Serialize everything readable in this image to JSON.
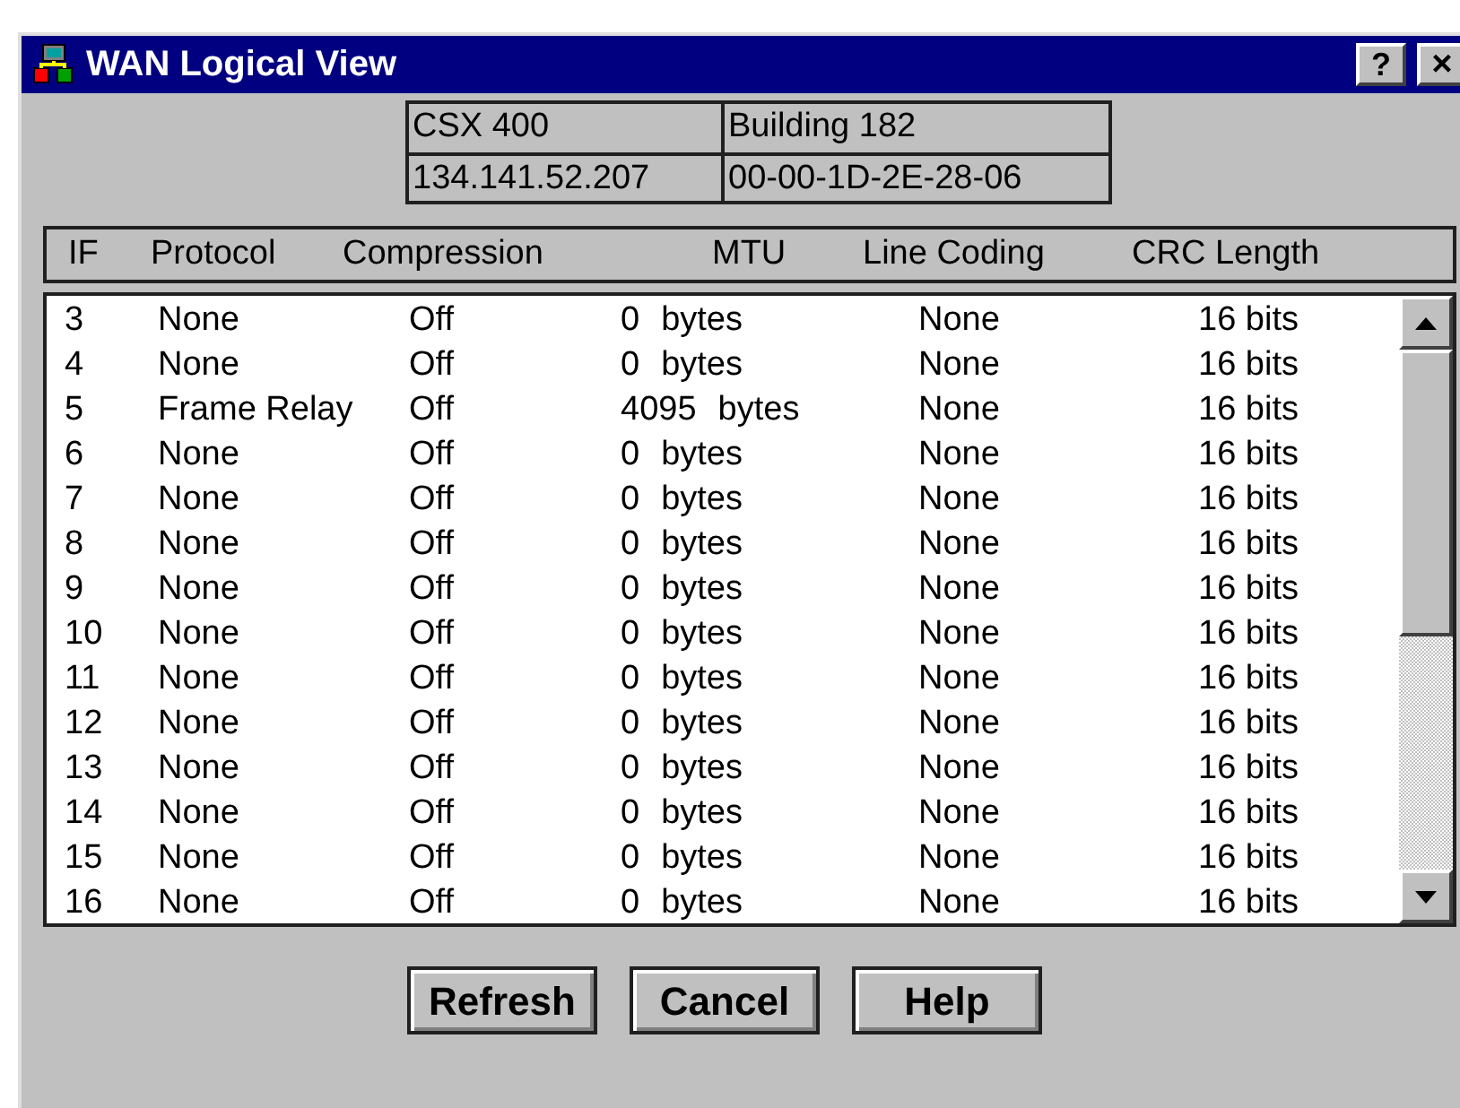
{
  "window": {
    "title": "WAN Logical View",
    "help_button": "?",
    "close_button": "×"
  },
  "device_info": [
    [
      "CSX 400",
      "Building 182"
    ],
    [
      "134.141.52.207",
      "00-00-1D-2E-28-06"
    ]
  ],
  "table": {
    "columns": [
      "IF",
      "Protocol",
      "Compression",
      "MTU",
      "Line Coding",
      "CRC Length"
    ],
    "rows": [
      {
        "if": "3",
        "protocol": "None",
        "compression": "Off",
        "mtu": "0",
        "mtu_unit": "bytes",
        "line_coding": "None",
        "crc_length": "16 bits"
      },
      {
        "if": "4",
        "protocol": "None",
        "compression": "Off",
        "mtu": "0",
        "mtu_unit": "bytes",
        "line_coding": "None",
        "crc_length": "16 bits"
      },
      {
        "if": "5",
        "protocol": "Frame Relay",
        "compression": "Off",
        "mtu": "4095",
        "mtu_unit": "bytes",
        "line_coding": "None",
        "crc_length": "16 bits"
      },
      {
        "if": "6",
        "protocol": "None",
        "compression": "Off",
        "mtu": "0",
        "mtu_unit": "bytes",
        "line_coding": "None",
        "crc_length": "16 bits"
      },
      {
        "if": "7",
        "protocol": "None",
        "compression": "Off",
        "mtu": "0",
        "mtu_unit": "bytes",
        "line_coding": "None",
        "crc_length": "16 bits"
      },
      {
        "if": "8",
        "protocol": "None",
        "compression": "Off",
        "mtu": "0",
        "mtu_unit": "bytes",
        "line_coding": "None",
        "crc_length": "16 bits"
      },
      {
        "if": "9",
        "protocol": "None",
        "compression": "Off",
        "mtu": "0",
        "mtu_unit": "bytes",
        "line_coding": "None",
        "crc_length": "16 bits"
      },
      {
        "if": "10",
        "protocol": "None",
        "compression": "Off",
        "mtu": "0",
        "mtu_unit": "bytes",
        "line_coding": "None",
        "crc_length": "16 bits"
      },
      {
        "if": "11",
        "protocol": "None",
        "compression": "Off",
        "mtu": "0",
        "mtu_unit": "bytes",
        "line_coding": "None",
        "crc_length": "16 bits"
      },
      {
        "if": "12",
        "protocol": "None",
        "compression": "Off",
        "mtu": "0",
        "mtu_unit": "bytes",
        "line_coding": "None",
        "crc_length": "16 bits"
      },
      {
        "if": "13",
        "protocol": "None",
        "compression": "Off",
        "mtu": "0",
        "mtu_unit": "bytes",
        "line_coding": "None",
        "crc_length": "16 bits"
      },
      {
        "if": "14",
        "protocol": "None",
        "compression": "Off",
        "mtu": "0",
        "mtu_unit": "bytes",
        "line_coding": "None",
        "crc_length": "16 bits"
      },
      {
        "if": "15",
        "protocol": "None",
        "compression": "Off",
        "mtu": "0",
        "mtu_unit": "bytes",
        "line_coding": "None",
        "crc_length": "16 bits"
      },
      {
        "if": "16",
        "protocol": "None",
        "compression": "Off",
        "mtu": "0",
        "mtu_unit": "bytes",
        "line_coding": "None",
        "crc_length": "16 bits"
      }
    ]
  },
  "buttons": [
    "Refresh",
    "Cancel",
    "Help"
  ]
}
